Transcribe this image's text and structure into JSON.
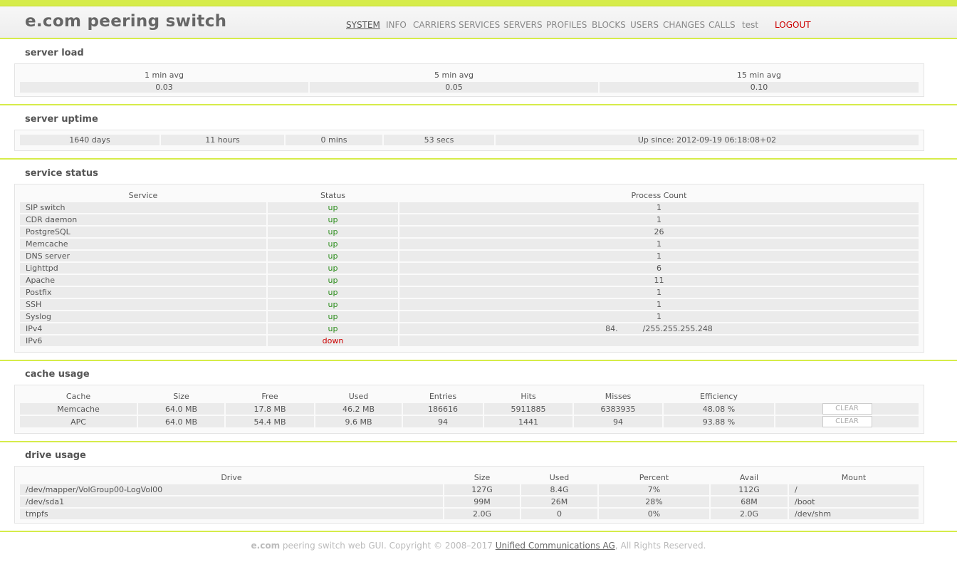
{
  "app": {
    "title": "e.com peering switch"
  },
  "nav": {
    "items": [
      "SYSTEM",
      "INFO",
      "CARRIERS",
      "SERVICES",
      "SERVERS",
      "PROFILES",
      "BLOCKS",
      "USERS",
      "CHANGES",
      "CALLS",
      "test"
    ],
    "logout": "LOGOUT"
  },
  "server_load": {
    "title": "server load",
    "headers": [
      "1 min avg",
      "5 min avg",
      "15 min avg"
    ],
    "values": [
      "0.03",
      "0.05",
      "0.10"
    ]
  },
  "server_uptime": {
    "title": "server uptime",
    "values": [
      "1640 days",
      "11 hours",
      "0 mins",
      "53 secs",
      "Up since: 2012-09-19 06:18:08+02"
    ]
  },
  "service_status": {
    "title": "service status",
    "headers": [
      "Service",
      "Status",
      "Process Count"
    ],
    "rows": [
      [
        "SIP switch",
        "up",
        "1"
      ],
      [
        "CDR daemon",
        "up",
        "1"
      ],
      [
        "PostgreSQL",
        "up",
        "26"
      ],
      [
        "Memcache",
        "up",
        "1"
      ],
      [
        "DNS server",
        "up",
        "1"
      ],
      [
        "Lighttpd",
        "up",
        "6"
      ],
      [
        "Apache",
        "up",
        "11"
      ],
      [
        "Postfix",
        "up",
        "1"
      ],
      [
        "SSH",
        "up",
        "1"
      ],
      [
        "Syslog",
        "up",
        "1"
      ],
      [
        "IPv4",
        "up",
        "84.          /255.255.255.248"
      ],
      [
        "IPv6",
        "down",
        ""
      ]
    ]
  },
  "cache_usage": {
    "title": "cache usage",
    "headers": [
      "Cache",
      "Size",
      "Free",
      "Used",
      "Entries",
      "Hits",
      "Misses",
      "Efficiency"
    ],
    "rows": [
      [
        "Memcache",
        "64.0 MB",
        "17.8 MB",
        "46.2 MB",
        "186616",
        "5911885",
        "6383935",
        "48.08 %"
      ],
      [
        "APC",
        "64.0 MB",
        "54.4 MB",
        "9.6 MB",
        "94",
        "1441",
        "94",
        "93.88 %"
      ]
    ],
    "clear_label": "CLEAR"
  },
  "drive_usage": {
    "title": "drive usage",
    "headers": [
      "Drive",
      "Size",
      "Used",
      "Percent",
      "Avail",
      "Mount"
    ],
    "rows": [
      [
        "/dev/mapper/VolGroup00-LogVol00",
        "127G",
        "8.4G",
        "7%",
        "112G",
        "/"
      ],
      [
        "/dev/sda1",
        "99M",
        "26M",
        "28%",
        "68M",
        "/boot"
      ],
      [
        "tmpfs",
        "2.0G",
        "0",
        "0%",
        "2.0G",
        "/dev/shm"
      ]
    ]
  },
  "footer": {
    "brand": "e.com",
    "text": " peering switch web GUI. Copyright © 2008–2017 ",
    "link": "Unified Communications AG",
    "suffix": ", All Rights Reserved."
  }
}
